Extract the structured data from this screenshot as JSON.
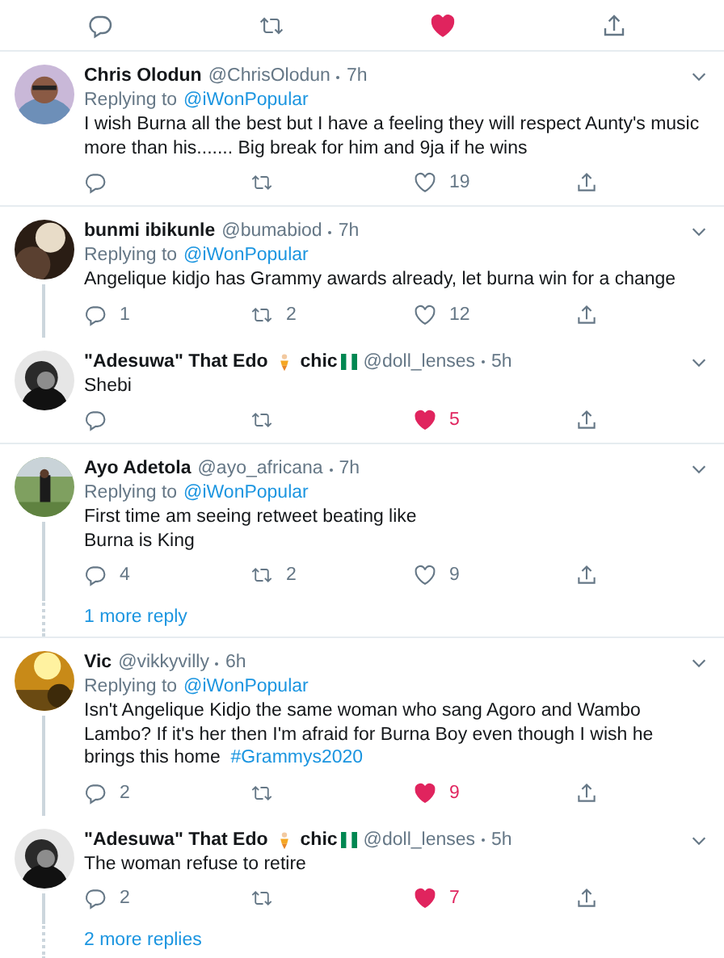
{
  "top_actions": {
    "liked": true
  },
  "threads": [
    {
      "tweets": [
        {
          "name": "Chris Olodun",
          "handle": "@ChrisOlodun",
          "time": "7h",
          "replying_label": "Replying to",
          "replying_to": "@iWonPopular",
          "text": "I wish Burna all the best but I have a feeling they will respect Aunty's music more than his....... Big break for him and 9ja if he wins",
          "likes": "19",
          "liked": false
        }
      ]
    },
    {
      "tweets": [
        {
          "name": "bunmi ibikunle",
          "handle": "@bumabiod",
          "time": "7h",
          "replying_label": "Replying to",
          "replying_to": "@iWonPopular",
          "text": "Angelique kidjo has Grammy awards already, let burna win for a change",
          "replies": "1",
          "retweets": "2",
          "likes": "12",
          "liked": false
        },
        {
          "name": "\"Adesuwa\" That Edo",
          "name_tail": "chic",
          "handle": "@doll_lenses",
          "time": "5h",
          "text": "Shebi",
          "likes": "5",
          "liked": true
        }
      ]
    },
    {
      "tweets": [
        {
          "name": "Ayo Adetola",
          "handle": "@ayo_africana",
          "time": "7h",
          "replying_label": "Replying to",
          "replying_to": "@iWonPopular",
          "text": "First time am seeing retweet beating like\nBurna is King",
          "replies": "4",
          "retweets": "2",
          "likes": "9",
          "liked": false
        }
      ],
      "more_replies": "1 more reply"
    },
    {
      "tweets": [
        {
          "name": "Vic",
          "handle": "@vikkyvilly",
          "time": "6h",
          "replying_label": "Replying to",
          "replying_to": "@iWonPopular",
          "text": "Isn't Angelique Kidjo the same woman who sang Agoro and Wambo Lambo? If it's her then I'm afraid for Burna Boy even though I wish he brings this home",
          "hashtag": "#Grammys2020",
          "replies": "2",
          "likes": "9",
          "liked": true
        },
        {
          "name": "\"Adesuwa\" That Edo",
          "name_tail": "chic",
          "handle": "@doll_lenses",
          "time": "5h",
          "text": "The woman refuse to retire",
          "replies": "2",
          "likes": "7",
          "liked": true
        }
      ],
      "more_replies": "2 more replies"
    }
  ]
}
